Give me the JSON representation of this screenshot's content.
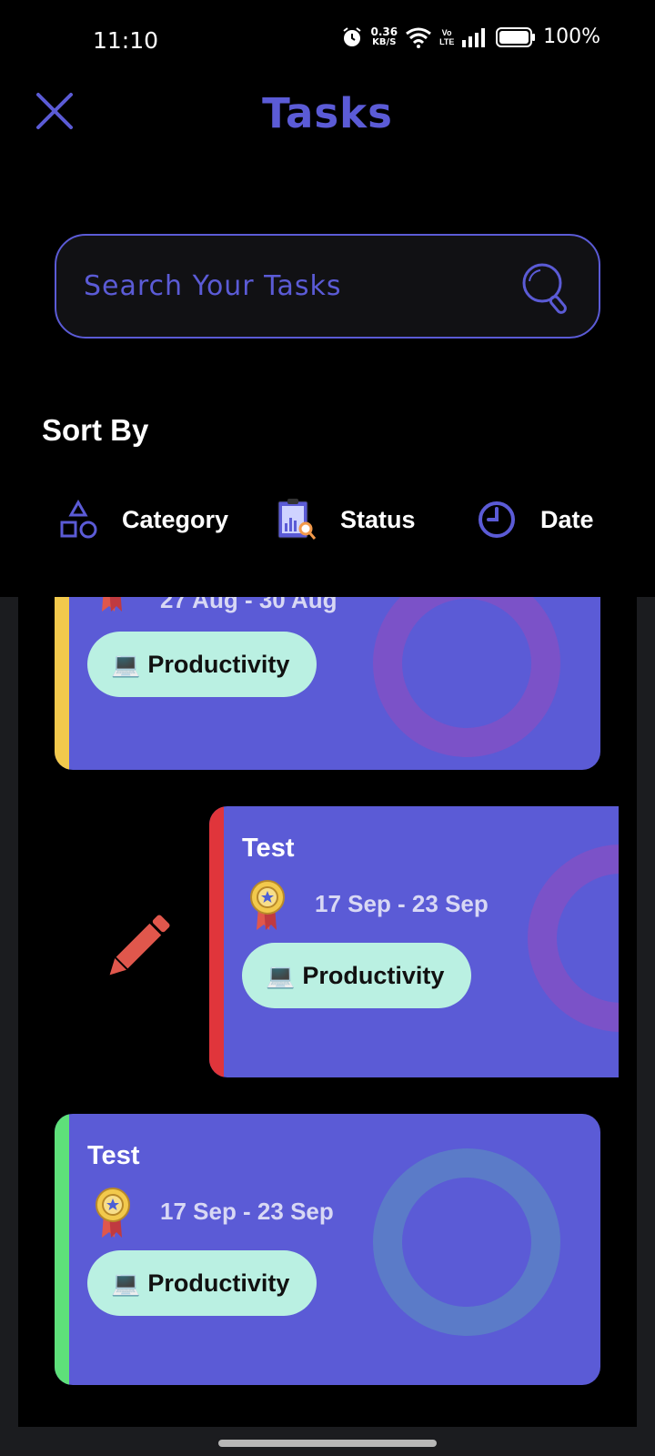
{
  "status_bar": {
    "time": "11:10",
    "speed_value": "0.36",
    "speed_unit": "KB/S",
    "network_label": "Vo LTE",
    "battery": "100%"
  },
  "header": {
    "title": "Tasks",
    "close_icon": "close-icon",
    "search_placeholder": "Search Your Tasks",
    "search_icon": "search-icon"
  },
  "sort": {
    "label": "Sort By",
    "options": [
      {
        "label": "Category",
        "icon": "shapes-icon"
      },
      {
        "label": "Status",
        "icon": "clipboard-chart-icon"
      },
      {
        "label": "Date",
        "icon": "clock-icon"
      }
    ]
  },
  "tasks": [
    {
      "title": "",
      "date": "27 Aug - 30 Aug",
      "category_emoji": "💻",
      "category": "Productivity",
      "stripe_color": "#F2C94C",
      "ring_color": "#7B52C8"
    },
    {
      "title": "Test",
      "date": "17 Sep - 23 Sep",
      "category_emoji": "💻",
      "category": "Productivity",
      "stripe_color": "#E0353B",
      "ring_color": "#7B52C8",
      "swiped": true
    },
    {
      "title": "Test",
      "date": "17 Sep - 23 Sep",
      "category_emoji": "💻",
      "category": "Productivity",
      "stripe_color": "#5EE07A",
      "ring_color": "#5B7BC8"
    }
  ],
  "swipe_action": {
    "icon": "pencil-icon",
    "color": "#E0574C"
  },
  "colors": {
    "accent": "#5B5BD6",
    "tag_background": "#BAF0E2",
    "panel": "#1B1C1F"
  }
}
